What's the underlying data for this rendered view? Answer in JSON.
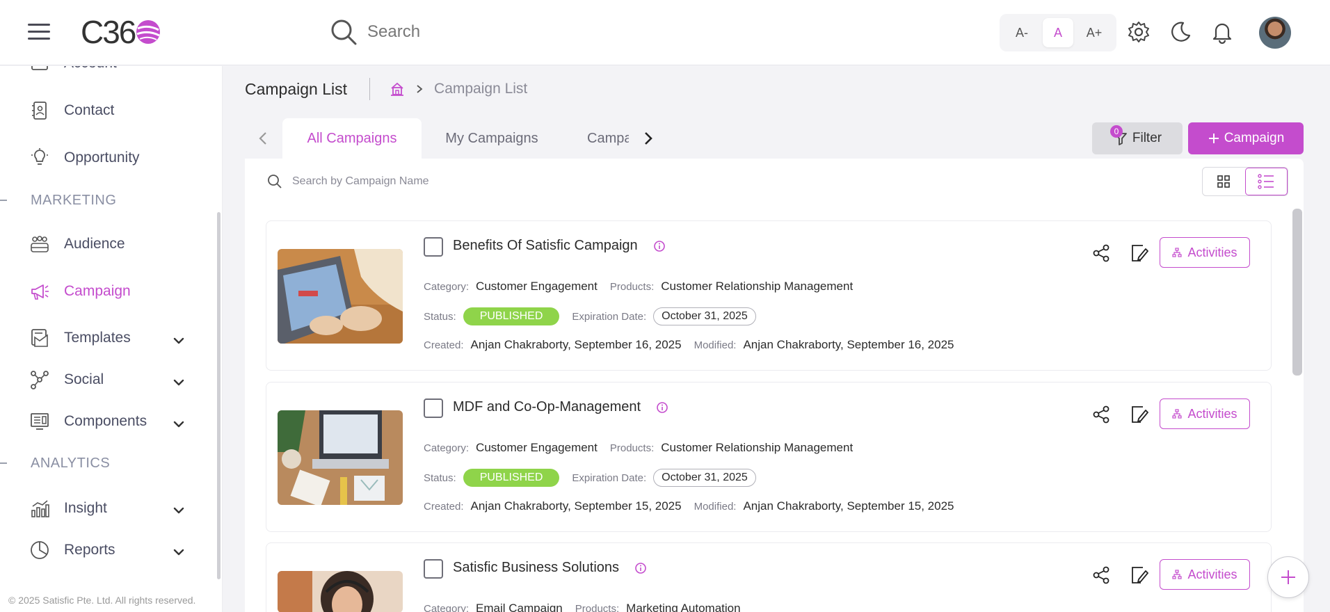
{
  "header": {
    "logo_text": "C36",
    "search_label": "Search",
    "font_controls": [
      {
        "label": "A-",
        "active": false
      },
      {
        "label": "A",
        "active": true
      },
      {
        "label": "A+",
        "active": false
      }
    ],
    "icons": [
      "settings-icon",
      "moon-icon",
      "bell-icon"
    ]
  },
  "sidebar": {
    "items_top": [
      {
        "label": "Account",
        "icon": "account-icon"
      },
      {
        "label": "Contact",
        "icon": "contact-icon"
      },
      {
        "label": "Opportunity",
        "icon": "lightbulb-icon"
      }
    ],
    "section_marketing": "MARKETING",
    "items_marketing": [
      {
        "label": "Audience",
        "icon": "audience-icon",
        "has_submenu": false,
        "active": false
      },
      {
        "label": "Campaign",
        "icon": "megaphone-icon",
        "has_submenu": false,
        "active": true
      },
      {
        "label": "Templates",
        "icon": "templates-icon",
        "has_submenu": true,
        "active": false
      },
      {
        "label": "Social",
        "icon": "social-icon",
        "has_submenu": true,
        "active": false
      },
      {
        "label": "Components",
        "icon": "components-icon",
        "has_submenu": true,
        "active": false
      }
    ],
    "section_analytics": "ANALYTICS",
    "items_analytics": [
      {
        "label": "Insight",
        "icon": "insight-icon",
        "has_submenu": true
      },
      {
        "label": "Reports",
        "icon": "reports-icon",
        "has_submenu": true
      }
    ],
    "footer": "© 2025 Satisfic Pte. Ltd. All rights reserved."
  },
  "page": {
    "title": "Campaign List",
    "breadcrumb_current": "Campaign List"
  },
  "tabs": [
    {
      "label": "All Campaigns",
      "active": true
    },
    {
      "label": "My Campaigns",
      "active": false
    },
    {
      "label": "Campa",
      "active": false
    }
  ],
  "toolbar": {
    "filter_label": "Filter",
    "filter_count": "0",
    "add_label": "Campaign"
  },
  "list_search": {
    "placeholder": "Search by Campaign Name"
  },
  "labels": {
    "category": "Category:",
    "products": "Products:",
    "status": "Status:",
    "expiration": "Expiration Date:",
    "created": "Created:",
    "modified": "Modified:",
    "activities": "Activities"
  },
  "campaigns": [
    {
      "title": "Benefits Of Satisfic Campaign",
      "category": "Customer Engagement",
      "products": "Customer Relationship Management",
      "status": "PUBLISHED",
      "expiration": "October 31, 2025",
      "created": "Anjan Chakraborty, September 16, 2025",
      "modified": "Anjan Chakraborty, September 16, 2025"
    },
    {
      "title": "MDF and Co-Op-Management",
      "category": "Customer Engagement",
      "products": "Customer Relationship Management",
      "status": "PUBLISHED",
      "expiration": "October 31, 2025",
      "created": "Anjan Chakraborty, September 15, 2025",
      "modified": "Anjan Chakraborty, September 15, 2025"
    },
    {
      "title": "Satisfic Business Solutions",
      "category": "Email Campaign",
      "products": "Marketing Automation"
    }
  ],
  "colors": {
    "accent": "#c44ccd",
    "published": "#8fd44a"
  }
}
